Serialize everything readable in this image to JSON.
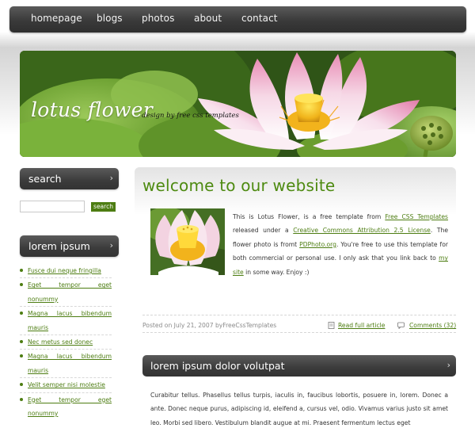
{
  "nav": {
    "items": [
      {
        "label": "homepage"
      },
      {
        "label": "blogs"
      },
      {
        "label": "photos"
      },
      {
        "label": "about"
      },
      {
        "label": "contact"
      }
    ]
  },
  "header": {
    "title": "lotus flower",
    "tagline": "design by free css templates"
  },
  "sidebar": {
    "search": {
      "heading": "search",
      "placeholder": "",
      "button_label": "search"
    },
    "links": {
      "heading": "lorem ipsum",
      "items": [
        "Fusce dui neque fringilla",
        "Eget tempor eget nonummy",
        "Magna lacus bibendum mauris",
        "Nec metus sed donec",
        "Magna lacus bibendum mauris",
        "Velit semper nisi molestie",
        "Eget tempor eget nonummy"
      ]
    },
    "chevron": "›"
  },
  "post1": {
    "title": "welcome to our website",
    "body": {
      "t1": "This is Lotus Flower, is a free template from ",
      "l1": "Free CSS Templates",
      "t2": " released under a ",
      "l2": "Creative Commons Attribution 2.5 License",
      "t3": ". The flower photo is fromt ",
      "l3": "PDPhoto.org",
      "t4": ". You're free to use this template for both commercial or personal use. I only ask that you link back to ",
      "l4": "my site",
      "t5": " in some way. Enjoy :)"
    },
    "meta": {
      "posted": "Posted on July 21, 2007 byFreeCssTemplates",
      "read_full": "Read full article",
      "comments": "Comments (32)"
    }
  },
  "post2": {
    "title": "lorem ipsum dolor volutpat",
    "body": "Curabitur tellus. Phasellus tellus turpis, iaculis in, faucibus lobortis, posuere in, lorem. Donec a ante. Donec neque purus, adipiscing id, eleifend a, cursus vel, odio. Vivamus varius justo sit amet leo. Morbi sed libero. Vestibulum blandit augue at mi. Praesent fermentum lectus eget"
  },
  "colors": {
    "accent": "#4d8a10",
    "nav_bg": "#3a3a3a",
    "link": "#4d7d12"
  }
}
